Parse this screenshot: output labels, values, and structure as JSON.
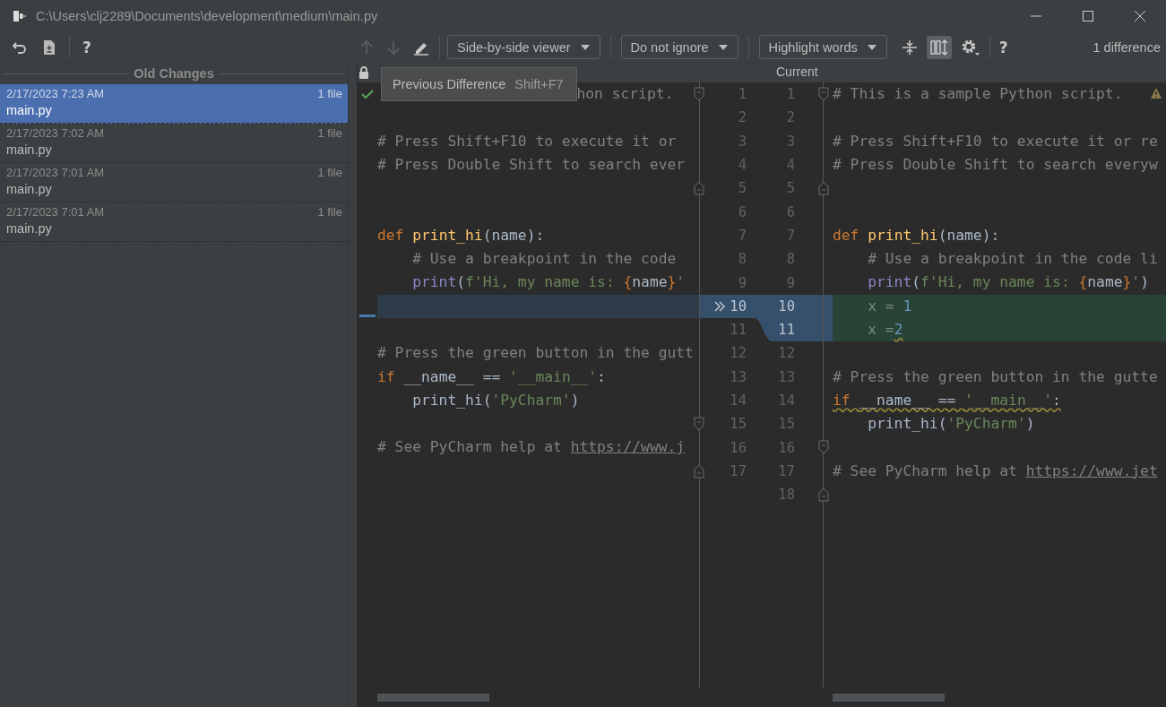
{
  "window": {
    "title": "C:\\Users\\clj2289\\Documents\\development\\medium\\main.py"
  },
  "toolbar": {
    "help": "?"
  },
  "sidebar": {
    "title": "Old Changes",
    "items": [
      {
        "time": "2/17/2023 7:23 AM",
        "count": "1 file",
        "name": "main.py",
        "selected": true
      },
      {
        "time": "2/17/2023 7:02 AM",
        "count": "1 file",
        "name": "main.py",
        "selected": false
      },
      {
        "time": "2/17/2023 7:01 AM",
        "count": "1 file",
        "name": "main.py",
        "selected": false
      },
      {
        "time": "2/17/2023 7:01 AM",
        "count": "1 file",
        "name": "main.py",
        "selected": false
      }
    ]
  },
  "diff_toolbar": {
    "previous_disabled": true,
    "next_disabled": true,
    "viewer": "Side-by-side viewer",
    "ignore": "Do not ignore",
    "highlight": "Highlight words",
    "sync_scroll_on": true,
    "help": "?",
    "summary": "1 difference"
  },
  "tooltip": {
    "label": "Previous Difference",
    "shortcut": "Shift+F7"
  },
  "right_header": "Current",
  "left_lines": [
    {
      "n": "1",
      "fold_start": true,
      "under_tooltip": true,
      "tokens": [
        {
          "kind": "comment",
          "t": "hon script."
        }
      ]
    },
    {
      "n": "2"
    },
    {
      "n": "3",
      "tokens": [
        {
          "kind": "comment",
          "t": "# Press Shift+F10 to execute it or"
        }
      ]
    },
    {
      "n": "4",
      "tokens": [
        {
          "kind": "comment",
          "t": "# Press Double Shift to search ever"
        }
      ]
    },
    {
      "n": "5",
      "fold_end": true
    },
    {
      "n": "6"
    },
    {
      "n": "7",
      "tokens": [
        {
          "kind": "keyword",
          "t": "def "
        },
        {
          "kind": "func",
          "t": "print_hi"
        },
        {
          "kind": "plain",
          "t": "(name):"
        }
      ]
    },
    {
      "n": "8",
      "tokens": [
        {
          "kind": "comment",
          "t": "    # Use a breakpoint in the code"
        }
      ]
    },
    {
      "n": "9",
      "tokens": [
        {
          "kind": "builtin",
          "t": "    print"
        },
        {
          "kind": "plain",
          "t": "("
        },
        {
          "kind": "string",
          "t": "f'Hi, my name is: "
        },
        {
          "kind": "brace",
          "t": "{"
        },
        {
          "kind": "plain",
          "t": "name"
        },
        {
          "kind": "brace",
          "t": "}"
        },
        {
          "kind": "string",
          "t": "'"
        }
      ]
    },
    {
      "n": "10",
      "changed": true
    },
    {
      "n": "11"
    },
    {
      "n": "12",
      "tokens": [
        {
          "kind": "comment",
          "t": "# Press the green button in the gutt"
        }
      ]
    },
    {
      "n": "13",
      "tokens": [
        {
          "kind": "keyword",
          "t": "if "
        },
        {
          "kind": "plain",
          "t": "__name__ == "
        },
        {
          "kind": "string",
          "t": "'__main__'"
        },
        {
          "kind": "plain",
          "t": ":"
        }
      ]
    },
    {
      "n": "14",
      "tokens": [
        {
          "kind": "plain",
          "t": "    print_hi("
        },
        {
          "kind": "string",
          "t": "'PyCharm'"
        },
        {
          "kind": "plain",
          "t": ")"
        }
      ]
    },
    {
      "n": "15",
      "fold_start": true
    },
    {
      "n": "16",
      "tokens": [
        {
          "kind": "comment",
          "t": "# See PyCharm help at "
        },
        {
          "kind": "link",
          "t": "https://www.j"
        }
      ]
    },
    {
      "n": "17",
      "fold_end": true
    }
  ],
  "right_lines": [
    {
      "n": "1",
      "fold_start": true,
      "tokens": [
        {
          "kind": "comment",
          "t": "# This is a sample Python script."
        }
      ]
    },
    {
      "n": "2"
    },
    {
      "n": "3",
      "tokens": [
        {
          "kind": "comment",
          "t": "# Press Shift+F10 to execute it or re"
        }
      ]
    },
    {
      "n": "4",
      "tokens": [
        {
          "kind": "comment",
          "t": "# Press Double Shift to search everyw"
        }
      ]
    },
    {
      "n": "5",
      "fold_end": true
    },
    {
      "n": "6"
    },
    {
      "n": "7",
      "tokens": [
        {
          "kind": "keyword",
          "t": "def "
        },
        {
          "kind": "func",
          "t": "print_hi"
        },
        {
          "kind": "plain",
          "t": "(name):"
        }
      ]
    },
    {
      "n": "8",
      "tokens": [
        {
          "kind": "comment",
          "t": "    # Use a breakpoint in the code li"
        }
      ]
    },
    {
      "n": "9",
      "tokens": [
        {
          "kind": "builtin",
          "t": "    print"
        },
        {
          "kind": "plain",
          "t": "("
        },
        {
          "kind": "string",
          "t": "f'Hi, my name is: "
        },
        {
          "kind": "brace",
          "t": "{"
        },
        {
          "kind": "plain",
          "t": "name"
        },
        {
          "kind": "brace",
          "t": "}"
        },
        {
          "kind": "string",
          "t": "'"
        },
        {
          "kind": "plain",
          "t": ")"
        }
      ]
    },
    {
      "n": "10",
      "changed": true,
      "tokens": [
        {
          "kind": "dim",
          "t": "    x = "
        },
        {
          "kind": "number",
          "t": "1"
        }
      ]
    },
    {
      "n": "11",
      "changed": true,
      "tokens": [
        {
          "kind": "dim",
          "t": "    x ="
        },
        {
          "kind": "number",
          "t": "2",
          "wavy": true
        }
      ]
    },
    {
      "n": "12"
    },
    {
      "n": "13",
      "tokens": [
        {
          "kind": "comment",
          "t": "# Press the green button in the gutte"
        }
      ]
    },
    {
      "n": "14",
      "tokens": [
        {
          "kind": "keyword",
          "t": "if ",
          "wavy": true
        },
        {
          "kind": "plain",
          "t": "__name__ == ",
          "wavy": true
        },
        {
          "kind": "string",
          "t": "'__main__'",
          "wavy": true
        },
        {
          "kind": "plain",
          "t": ":",
          "wavy": true
        }
      ]
    },
    {
      "n": "15",
      "tokens": [
        {
          "kind": "plain",
          "t": "    print_hi("
        },
        {
          "kind": "string",
          "t": "'PyCharm'"
        },
        {
          "kind": "plain",
          "t": ")"
        }
      ]
    },
    {
      "n": "16",
      "fold_start": true
    },
    {
      "n": "17",
      "tokens": [
        {
          "kind": "comment",
          "t": "# See PyCharm help at "
        },
        {
          "kind": "link",
          "t": "https://www.jet"
        }
      ]
    },
    {
      "n": "18",
      "fold_end": true
    }
  ]
}
